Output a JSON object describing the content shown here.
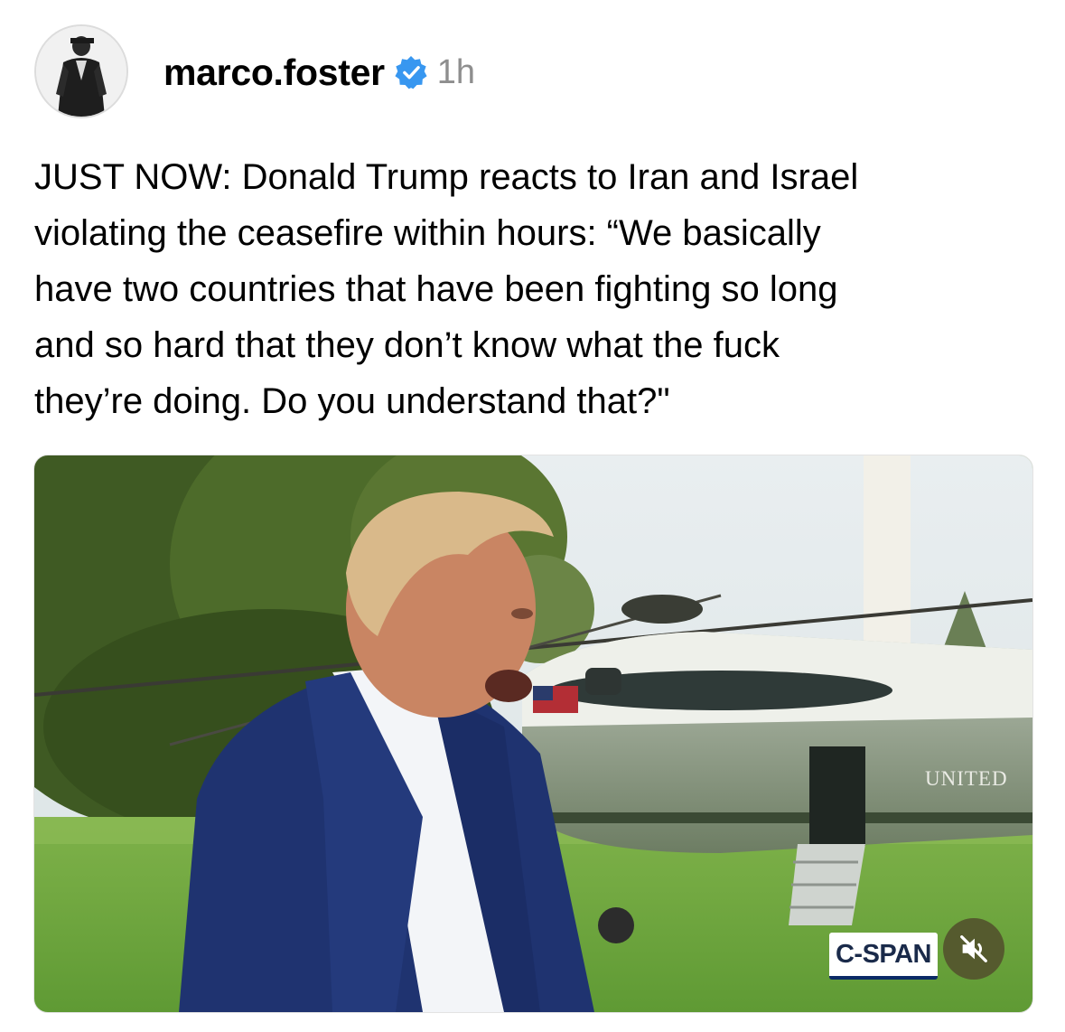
{
  "post": {
    "username": "marco.foster",
    "verified": true,
    "timestamp": "1h",
    "text": "JUST NOW: Donald Trump reacts to Iran and Israel\nviolating the ceasefire within hours: “We basically\nhave two countries that have been fighting so long\nand so hard that they don’t know what the fuck\nthey’re doing. Do you understand that?\""
  },
  "media": {
    "watermark": "C-SPAN",
    "aircraft_label": "UNITED",
    "mute_icon": "speaker-muted-icon"
  },
  "colors": {
    "verified_badge": "#3897f0",
    "timestamp": "#8e8e8e",
    "mute_button": "#555a2e"
  }
}
